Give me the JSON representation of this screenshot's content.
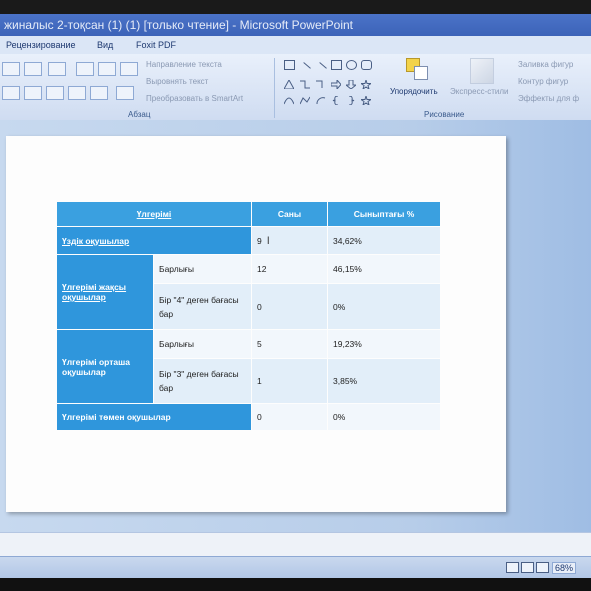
{
  "window": {
    "title": "жиналыс 2-тоқсан (1) (1) [только чтение] - Microsoft PowerPoint"
  },
  "menu": {
    "items": [
      "Рецензирование",
      "Вид",
      "Foxit PDF"
    ]
  },
  "ribbon": {
    "paragraph": {
      "group_label": "Абзац",
      "text_direction": "Направление текста",
      "align_text": "Выровнять текст",
      "convert_smartart": "Преобразовать в SmartArt"
    },
    "drawing": {
      "group_label": "Рисование",
      "arrange": "Упорядочить",
      "express_styles": "Экспресс-стили",
      "shape_fill": "Заливка фигур",
      "shape_outline": "Контур фигур",
      "shape_effects": "Эффекты для ф"
    }
  },
  "table": {
    "headers": [
      "Үлгерімі",
      "Саны",
      "Сыныптағы %"
    ],
    "rows": {
      "excellent": {
        "label": "Үздік оқушылар",
        "count": "9",
        "percent": "34,62%"
      },
      "good_label": "Үлгерімі жақсы оқушылар",
      "good_total": {
        "label": "Барлығы",
        "count": "12",
        "percent": "46,15%"
      },
      "good_one4": {
        "label": "Бір \"4\" деген бағасы бар",
        "count": "0",
        "percent": "0%"
      },
      "average_label": "Үлгерімі орташа оқушылар",
      "average_total": {
        "label": "Барлығы",
        "count": "5",
        "percent": "19,23%"
      },
      "average_one3": {
        "label": "Бір \"3\" деген бағасы бар",
        "count": "1",
        "percent": "3,85%"
      },
      "low": {
        "label": "Үлгерімі төмен оқушылар",
        "count": "0",
        "percent": "0%"
      }
    }
  },
  "status": {
    "zoom": "68%"
  }
}
